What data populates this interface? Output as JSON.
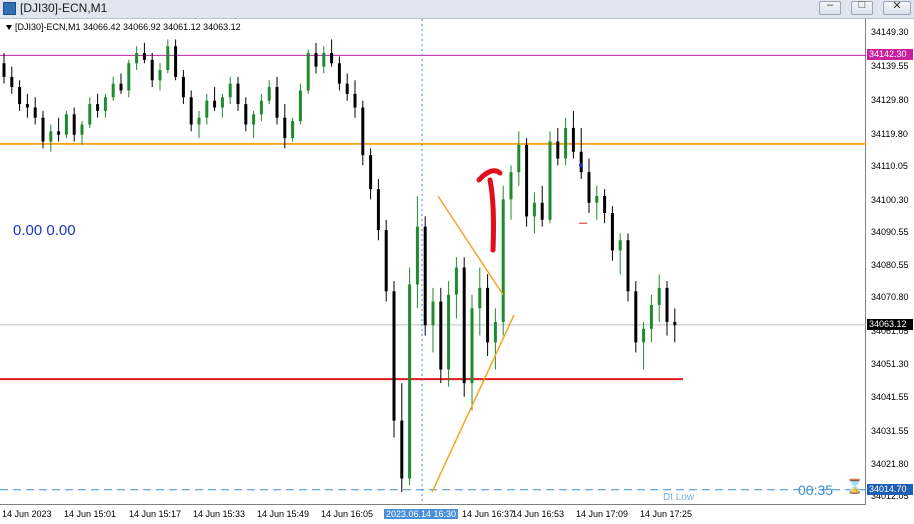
{
  "window": {
    "title": "[DJI30]-ECN,M1",
    "min_glyph": "–",
    "max_glyph": "□",
    "close_glyph": "✕",
    "icon": "chart-window-icon"
  },
  "chart_header": {
    "info": "[DJI30]-ECN,M1  34066.42 34066.92 34061.12 34063.12"
  },
  "overlays": {
    "zero_label": "0.00 0.00",
    "timer": "00:35",
    "hourglass": "⌛",
    "dt_low": "Dt Low"
  },
  "colors": {
    "bull": "#1f8a2e",
    "bear": "#000000",
    "orange": "#f5a623",
    "red": "#e01b1b",
    "magenta": "#c023a8",
    "dashed_blue": "#3b8fd8",
    "arrow_red": "#e0101a"
  },
  "price_axis": {
    "labels": [
      "34149.30",
      "34139.55",
      "34129.80",
      "34119.80",
      "34110.05",
      "34100.30",
      "34090.55",
      "34080.55",
      "34070.80",
      "34061.05",
      "34051.30",
      "34041.55",
      "34031.55",
      "34021.80",
      "34012.05"
    ],
    "markers": {
      "magenta": "34142.30",
      "current": "34063.12",
      "low": "34014.70"
    }
  },
  "time_axis": {
    "labels": [
      "14 Jun 2023",
      "14 Jun 15:01",
      "14 Jun 15:17",
      "14 Jun 15:33",
      "14 Jun 15:49",
      "14 Jun 16:05",
      "2023.06.14 16:30",
      "14 Jun 16:37",
      "14 Jun 16:53",
      "14 Jun 17:09",
      "14 Jun 17:25"
    ]
  },
  "chart_data": {
    "type": "candlestick",
    "ylim": [
      34010.5,
      34153.0
    ],
    "levels": {
      "magenta": 34142.3,
      "orange": 34116.3,
      "red": 34047.2,
      "dashed_low": 34014.7,
      "current": 34063.12
    },
    "candles": [
      [
        34140,
        34143,
        34134,
        34136
      ],
      [
        34136,
        34139,
        34131,
        34133
      ],
      [
        34133,
        34135,
        34126,
        34128
      ],
      [
        34128,
        34131,
        34124,
        34127
      ],
      [
        34127,
        34130,
        34122,
        34124
      ],
      [
        34124,
        34126,
        34115,
        34117
      ],
      [
        34117,
        34122,
        34114,
        34120
      ],
      [
        34120,
        34124,
        34117,
        34119
      ],
      [
        34119,
        34126,
        34118,
        34125
      ],
      [
        34125,
        34127,
        34117,
        34119
      ],
      [
        34119,
        34123,
        34116,
        34122
      ],
      [
        34122,
        34130,
        34121,
        34128
      ],
      [
        34128,
        34131,
        34124,
        34126
      ],
      [
        34126,
        34131,
        34124,
        34130
      ],
      [
        34130,
        34136,
        34129,
        34134
      ],
      [
        34134,
        34137,
        34131,
        34132
      ],
      [
        34132,
        34141,
        34130,
        34140
      ],
      [
        34140,
        34145,
        34138,
        34143
      ],
      [
        34143,
        34146,
        34140,
        34141
      ],
      [
        34141,
        34143,
        34133,
        34135
      ],
      [
        34135,
        34140,
        34132,
        34138
      ],
      [
        34138,
        34147,
        34137,
        34145
      ],
      [
        34145,
        34147,
        34135,
        34136
      ],
      [
        34136,
        34138,
        34128,
        34130
      ],
      [
        34130,
        34132,
        34120,
        34122
      ],
      [
        34122,
        34126,
        34118,
        34124
      ],
      [
        34124,
        34131,
        34122,
        34129
      ],
      [
        34129,
        34133,
        34126,
        34127
      ],
      [
        34127,
        34131,
        34124,
        34130
      ],
      [
        34130,
        34136,
        34128,
        34134
      ],
      [
        34134,
        34136,
        34126,
        34128
      ],
      [
        34128,
        34130,
        34120,
        34122
      ],
      [
        34122,
        34126,
        34118,
        34125
      ],
      [
        34125,
        34131,
        34123,
        34129
      ],
      [
        34129,
        34135,
        34128,
        34133
      ],
      [
        34133,
        34136,
        34122,
        34124
      ],
      [
        34124,
        34128,
        34115,
        34118
      ],
      [
        34118,
        34124,
        34117,
        34123
      ],
      [
        34123,
        34134,
        34122,
        34132
      ],
      [
        34132,
        34144,
        34131,
        34143
      ],
      [
        34143,
        34146,
        34137,
        34139
      ],
      [
        34139,
        34145,
        34137,
        34143
      ],
      [
        34143,
        34147,
        34139,
        34140
      ],
      [
        34140,
        34142,
        34132,
        34134
      ],
      [
        34134,
        34137,
        34129,
        34131
      ],
      [
        34131,
        34135,
        34124,
        34127
      ],
      [
        34127,
        34129,
        34110,
        34113
      ],
      [
        34113,
        34115,
        34100,
        34103
      ],
      [
        34103,
        34106,
        34088,
        34091
      ],
      [
        34091,
        34094,
        34070,
        34073
      ],
      [
        34073,
        34076,
        34030,
        34035
      ],
      [
        34035,
        34046,
        34014,
        34018
      ],
      [
        34018,
        34080,
        34016,
        34075
      ],
      [
        34075,
        34101,
        34068,
        34092
      ],
      [
        34092,
        34095,
        34060,
        34063
      ],
      [
        34063,
        34074,
        34055,
        34070
      ],
      [
        34070,
        34074,
        34046,
        34050
      ],
      [
        34050,
        34076,
        34045,
        34072
      ],
      [
        34072,
        34083,
        34065,
        34080
      ],
      [
        34080,
        34083,
        34042,
        34046
      ],
      [
        34046,
        34072,
        34038,
        34068
      ],
      [
        34068,
        34080,
        34060,
        34074
      ],
      [
        34074,
        34078,
        34054,
        34058
      ],
      [
        34058,
        34068,
        34050,
        34064
      ],
      [
        34064,
        34104,
        34060,
        34100
      ],
      [
        34100,
        34110,
        34094,
        34108
      ],
      [
        34108,
        34120,
        34104,
        34116
      ],
      [
        34116,
        34118,
        34092,
        34095
      ],
      [
        34095,
        34102,
        34090,
        34099
      ],
      [
        34099,
        34104,
        34092,
        34094
      ],
      [
        34094,
        34120,
        34093,
        34117
      ],
      [
        34117,
        34121,
        34110,
        34112
      ],
      [
        34112,
        34124,
        34110,
        34121
      ],
      [
        34121,
        34126,
        34112,
        34114
      ],
      [
        34114,
        34121,
        34106,
        34108
      ],
      [
        34108,
        34112,
        34096,
        34099
      ],
      [
        34099,
        34104,
        34094,
        34101
      ],
      [
        34101,
        34103,
        34093,
        34096
      ],
      [
        34096,
        34098,
        34082,
        34085
      ],
      [
        34085,
        34090,
        34078,
        34088
      ],
      [
        34088,
        34090,
        34070,
        34073
      ],
      [
        34073,
        34076,
        34055,
        34058
      ],
      [
        34058,
        34064,
        34050,
        34062
      ],
      [
        34062,
        34072,
        34058,
        34069
      ],
      [
        34069,
        34078,
        34064,
        34074
      ],
      [
        34074,
        34076,
        34060,
        34064
      ],
      [
        34064,
        34068,
        34058,
        34063
      ]
    ]
  }
}
